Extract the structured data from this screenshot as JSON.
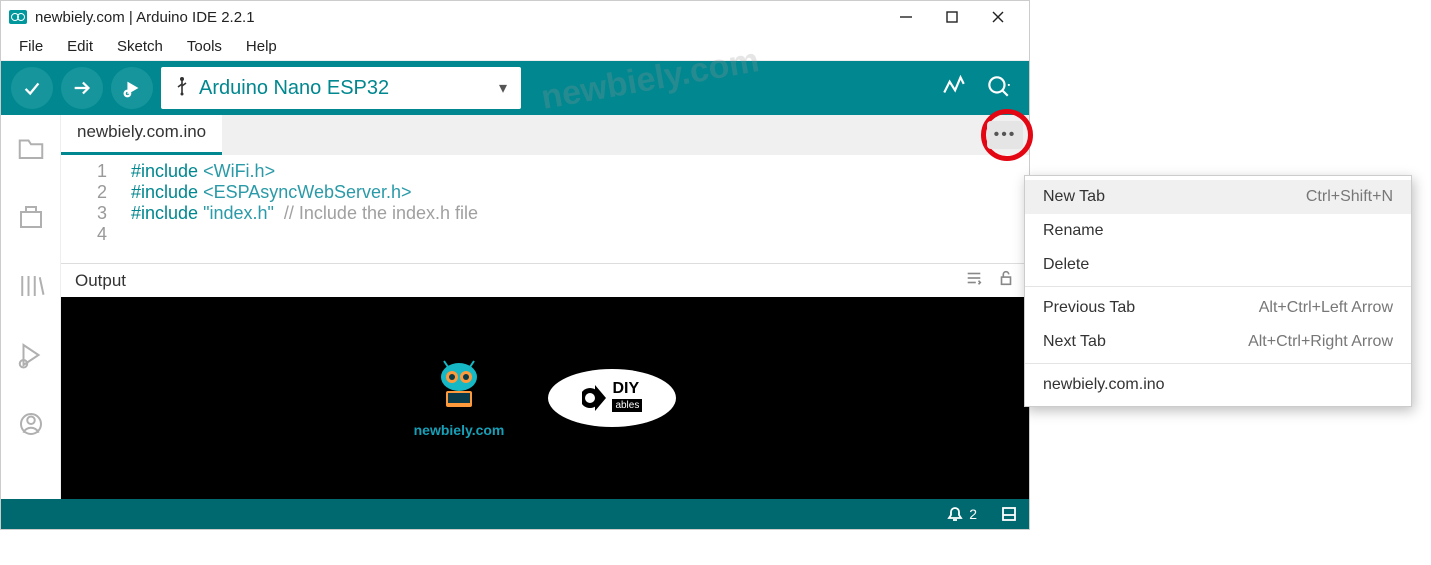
{
  "titlebar": {
    "title": "newbiely.com | Arduino IDE 2.2.1"
  },
  "menubar": {
    "file": "File",
    "edit": "Edit",
    "sketch": "Sketch",
    "tools": "Tools",
    "help": "Help"
  },
  "toolbar": {
    "board": "Arduino Nano ESP32"
  },
  "tab": {
    "filename": "newbiely.com.ino"
  },
  "code": {
    "l1": {
      "n": "1",
      "inc": "#include",
      "arg": " <WiFi.h>"
    },
    "l2": {
      "n": "2",
      "inc": "#include",
      "arg": " <ESPAsyncWebServer.h>"
    },
    "l3": {
      "n": "3",
      "inc": "#include",
      "arg": " \"index.h\"",
      "gap": "  ",
      "cmt": "// Include the index.h file"
    },
    "l4": {
      "n": "4"
    }
  },
  "output": {
    "label": "Output",
    "nb_text": "newbiely.com",
    "diy_top": "DIY",
    "diy_sub": "ables"
  },
  "statusbar": {
    "notif_count": "2"
  },
  "ctx": {
    "new_tab": "New Tab",
    "new_tab_sc": "Ctrl+Shift+N",
    "rename": "Rename",
    "delete": "Delete",
    "prev": "Previous Tab",
    "prev_sc": "Alt+Ctrl+Left Arrow",
    "next": "Next Tab",
    "next_sc": "Alt+Ctrl+Right Arrow",
    "file": "newbiely.com.ino"
  },
  "watermark": "newbiely.com"
}
